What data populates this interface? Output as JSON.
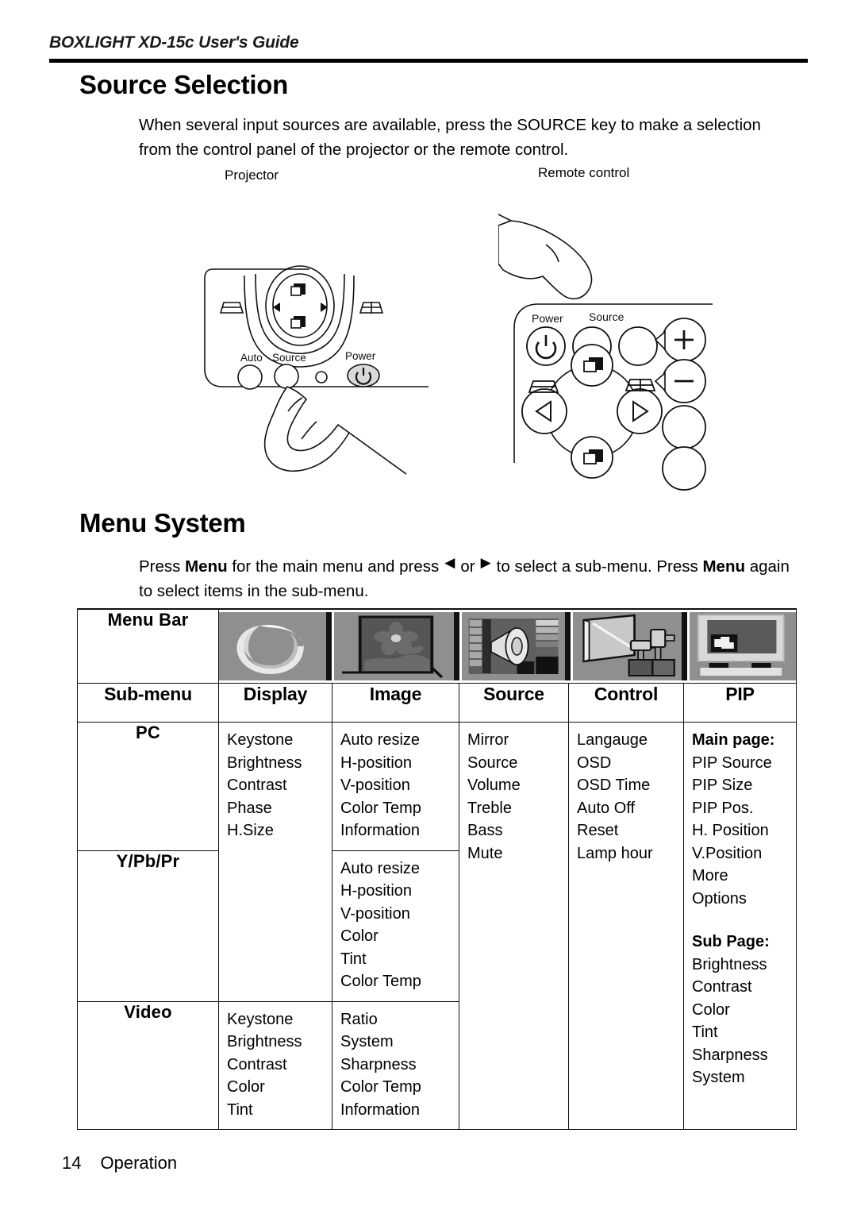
{
  "header": {
    "running_head": "BOXLIGHT XD-15c User's Guide"
  },
  "sections": {
    "source_selection": {
      "heading": "Source Selection",
      "paragraph_before": "When several input sources are available, press the SOURCE key to make a selection from the control panel of the projector or the remote control."
    },
    "menu_system": {
      "heading": "Menu System",
      "text_1": "Press ",
      "bold_1": "Menu",
      "text_2": " for the main menu and press",
      "arrow_left": "◀",
      "text_3": "or",
      "arrow_right": "▶",
      "text_4": "to select a sub-menu. Press ",
      "bold_2": "Menu",
      "text_5": " again to select items in the sub-menu."
    }
  },
  "figures": {
    "projector": {
      "caption": "Projector",
      "labels": {
        "auto": "Auto",
        "source": "Source",
        "power": "Power"
      }
    },
    "remote": {
      "caption": "Remote control",
      "labels": {
        "power": "Power",
        "source": "Source"
      }
    }
  },
  "menu_table": {
    "row_labels": {
      "menu_bar": "Menu Bar",
      "sub_menu": "Sub-menu"
    },
    "columns": [
      "Display",
      "Image",
      "Source",
      "Control",
      "PIP"
    ],
    "thumbnails": [
      "display-swirl-icon",
      "image-picture-icon",
      "source-speaker-icon",
      "control-projector-icon",
      "pip-monitor-icon"
    ],
    "rows": [
      {
        "label": "PC",
        "display": [
          "Keystone",
          "Brightness",
          "Contrast",
          "Phase",
          "H.Size"
        ],
        "image": [
          "Auto resize",
          "H-position",
          "V-position",
          "Color Temp",
          "Information"
        ]
      },
      {
        "label": "Y/Pb/Pr",
        "display": [],
        "image": [
          "Auto resize",
          "H-position",
          "V-position",
          "Color",
          "Tint",
          "Color Temp"
        ]
      },
      {
        "label": "Video",
        "display": [
          "Keystone",
          "Brightness",
          "Contrast",
          "Color",
          "Tint"
        ],
        "image": [
          "Ratio",
          "System",
          "Sharpness",
          "Color Temp",
          "Information"
        ]
      }
    ],
    "source_items": [
      "Mirror",
      "Source",
      "Volume",
      "Treble",
      "Bass",
      "Mute"
    ],
    "control_items": [
      "Langauge",
      "OSD",
      "OSD Time",
      "Auto Off",
      "Reset",
      "Lamp hour"
    ],
    "pip_items": [
      {
        "text": "Main page:",
        "bold": true
      },
      {
        "text": "PIP Source",
        "bold": false
      },
      {
        "text": "PIP Size",
        "bold": false
      },
      {
        "text": "PIP Pos.",
        "bold": false
      },
      {
        "text": "H. Position",
        "bold": false
      },
      {
        "text": "V.Position",
        "bold": false
      },
      {
        "text": "More",
        "bold": false
      },
      {
        "text": "Options",
        "bold": false
      },
      {
        "text": "",
        "bold": false
      },
      {
        "text": "Sub Page:",
        "bold": true
      },
      {
        "text": "Brightness",
        "bold": false
      },
      {
        "text": "Contrast",
        "bold": false
      },
      {
        "text": "Color",
        "bold": false
      },
      {
        "text": "Tint",
        "bold": false
      },
      {
        "text": "Sharpness",
        "bold": false
      },
      {
        "text": "System",
        "bold": false
      }
    ]
  },
  "footer": {
    "page_number": "14",
    "section_name": "Operation"
  }
}
